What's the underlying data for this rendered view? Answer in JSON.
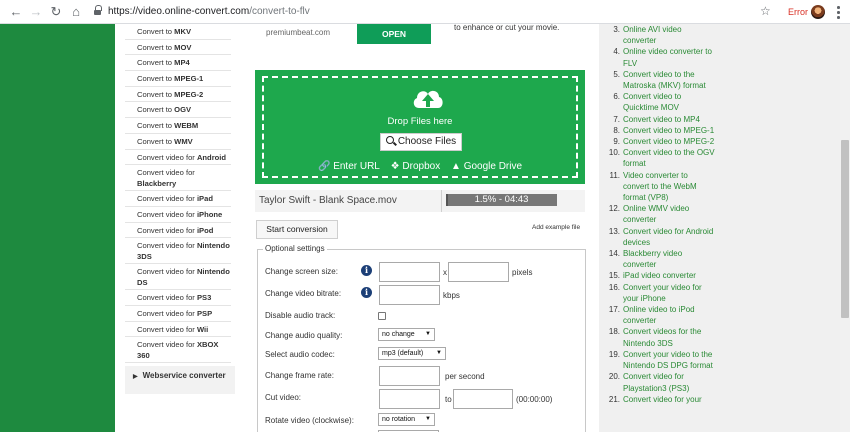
{
  "browser": {
    "url_host": "https://video.online-convert.com",
    "url_path": "/convert-to-flv",
    "error_label": "Error"
  },
  "sidebar": {
    "items": [
      {
        "prefix": "Convert to ",
        "bold": "MKV"
      },
      {
        "prefix": "Convert to ",
        "bold": "MOV"
      },
      {
        "prefix": "Convert to ",
        "bold": "MP4"
      },
      {
        "prefix": "Convert to ",
        "bold": "MPEG-1"
      },
      {
        "prefix": "Convert to ",
        "bold": "MPEG-2"
      },
      {
        "prefix": "Convert to ",
        "bold": "OGV"
      },
      {
        "prefix": "Convert to ",
        "bold": "WEBM"
      },
      {
        "prefix": "Convert to ",
        "bold": "WMV"
      },
      {
        "prefix": "Convert video for ",
        "bold": "Android"
      },
      {
        "prefix": "Convert video for ",
        "bold": "Blackberry"
      },
      {
        "prefix": "Convert video for ",
        "bold": "iPad"
      },
      {
        "prefix": "Convert video for ",
        "bold": "iPhone"
      },
      {
        "prefix": "Convert video for ",
        "bold": "iPod"
      },
      {
        "prefix": "Convert video for ",
        "bold": "Nintendo 3DS"
      },
      {
        "prefix": "Convert video for ",
        "bold": "Nintendo DS"
      },
      {
        "prefix": "Convert video for ",
        "bold": "PS3"
      },
      {
        "prefix": "Convert video for ",
        "bold": "PSP"
      },
      {
        "prefix": "Convert video for ",
        "bold": "Wii"
      },
      {
        "prefix": "Convert video for ",
        "bold": "XBOX 360"
      }
    ],
    "webservice_label": "Webservice converter"
  },
  "ad": {
    "site": "premiumbeat.com",
    "open_label": "OPEN",
    "side_text": "to enhance or cut your movie."
  },
  "upload": {
    "drop_title": "Drop Files here",
    "choose_label": "Choose Files",
    "enter_url": "Enter URL",
    "dropbox": "Dropbox",
    "google_drive": "Google Drive"
  },
  "file": {
    "name": "Taylor Swift - Blank Space.mov",
    "progress_text": "1.5% - 04:43",
    "progress_fraction": 0.015
  },
  "actions": {
    "start_label": "Start conversion",
    "add_example": "Add example file"
  },
  "options": {
    "legend": "Optional settings",
    "screen_size_label": "Change screen size:",
    "x_sep": "x",
    "pixels": "pixels",
    "bitrate_label": "Change video bitrate:",
    "kbps": "kbps",
    "disable_audio_label": "Disable audio track:",
    "audio_quality_label": "Change audio quality:",
    "audio_quality_value": "no change",
    "audio_codec_label": "Select audio codec:",
    "audio_codec_value": "mp3 (default)",
    "frame_rate_label": "Change frame rate:",
    "per_second": "per second",
    "cut_label": "Cut video:",
    "to": "to",
    "time_hint": "(00:00:00)",
    "rotate_label": "Rotate video (clockwise):",
    "rotate_value": "no rotation"
  },
  "right_list": [
    {
      "n": "3.",
      "t": "Online AVI video converter"
    },
    {
      "n": "4.",
      "t": "Online video converter to FLV"
    },
    {
      "n": "5.",
      "t": "Convert video to the Matroska (MKV) format"
    },
    {
      "n": "6.",
      "t": "Convert video to Quicktime MOV"
    },
    {
      "n": "7.",
      "t": "Convert video to MP4"
    },
    {
      "n": "8.",
      "t": "Convert video to MPEG-1"
    },
    {
      "n": "9.",
      "t": "Convert video to MPEG-2"
    },
    {
      "n": "10.",
      "t": "Convert video to the OGV format"
    },
    {
      "n": "11.",
      "t": "Video converter to convert to the WebM format (VP8)"
    },
    {
      "n": "12.",
      "t": "Online WMV video converter"
    },
    {
      "n": "13.",
      "t": "Convert video for Android devices"
    },
    {
      "n": "14.",
      "t": "Blackberry video converter"
    },
    {
      "n": "15.",
      "t": "iPad video converter"
    },
    {
      "n": "16.",
      "t": "Convert your video for your iPhone"
    },
    {
      "n": "17.",
      "t": "Online video to iPod converter"
    },
    {
      "n": "18.",
      "t": "Convert videos for the Nintendo 3DS"
    },
    {
      "n": "19.",
      "t": "Convert your video to the Nintendo DS DPG format"
    },
    {
      "n": "20.",
      "t": "Convert video for Playstation3 (PS3)"
    },
    {
      "n": "21.",
      "t": "Convert video for your"
    }
  ],
  "colors": {
    "brand_green": "#1e8a3f",
    "drop_green": "#1ea84d",
    "link_green": "#2a8a35",
    "info_blue": "#1c3f77"
  }
}
